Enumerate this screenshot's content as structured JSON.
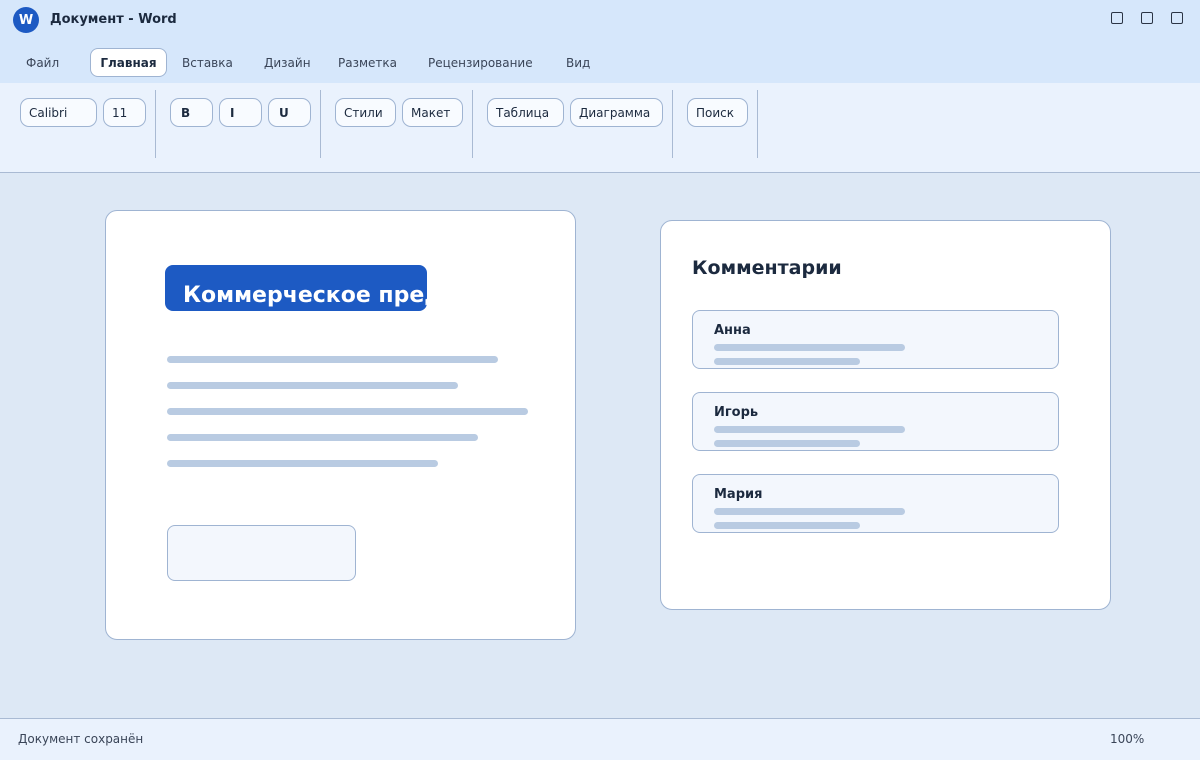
{
  "window": {
    "title": "Документ - Word",
    "logo_letter": "W"
  },
  "tabs": [
    {
      "label": "Файл"
    },
    {
      "label": "Главная",
      "active": true
    },
    {
      "label": "Вставка"
    },
    {
      "label": "Дизайн"
    },
    {
      "label": "Разметка"
    },
    {
      "label": "Рецензирование"
    },
    {
      "label": "Вид"
    }
  ],
  "ribbon": {
    "font_name": "Calibri",
    "font_size": "11",
    "bold": "B",
    "italic": "I",
    "underline": "U",
    "styles": "Стили",
    "layout": "Макет",
    "table": "Таблица",
    "chart": "Диаграмма",
    "search": "Поиск"
  },
  "document": {
    "heading": "Коммерческое предложение"
  },
  "comments": {
    "title": "Комментарии",
    "items": [
      {
        "author": "Анна"
      },
      {
        "author": "Игорь"
      },
      {
        "author": "Мария"
      }
    ]
  },
  "status": {
    "message": "Документ сохранён",
    "zoom": "100%"
  },
  "colors": {
    "accent": "#1d5ac3",
    "titlebar": "#d6e7fb",
    "canvas": "#dde8f5"
  }
}
